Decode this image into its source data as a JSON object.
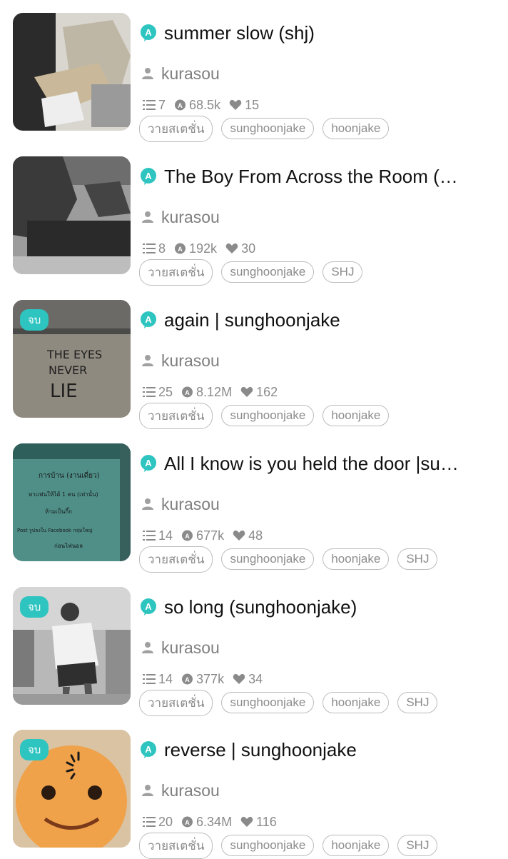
{
  "stories": [
    {
      "title": "summer slow (shj)",
      "author": "kurasou",
      "parts": "7",
      "reads": "68.5k",
      "votes": "15",
      "completed": false,
      "completed_label": "",
      "tags": [
        "วายสเตชั่น",
        "sunghoonjake",
        "hoonjake"
      ]
    },
    {
      "title": "The Boy  From Across the Room (…",
      "author": "kurasou",
      "parts": "8",
      "reads": "192k",
      "votes": "30",
      "completed": false,
      "completed_label": "",
      "tags": [
        "วายสเตชั่น",
        "sunghoonjake",
        "SHJ"
      ]
    },
    {
      "title": "again | sunghoonjake",
      "author": "kurasou",
      "parts": "25",
      "reads": "8.12M",
      "votes": "162",
      "completed": true,
      "completed_label": "จบ",
      "tags": [
        "วายสเตชั่น",
        "sunghoonjake",
        "hoonjake"
      ]
    },
    {
      "title": "All I know is you held the door |su…",
      "author": "kurasou",
      "parts": "14",
      "reads": "677k",
      "votes": "48",
      "completed": false,
      "completed_label": "",
      "tags": [
        "วายสเตชั่น",
        "sunghoonjake",
        "hoonjake",
        "SHJ"
      ]
    },
    {
      "title": "so long (sunghoonjake)",
      "author": "kurasou",
      "parts": "14",
      "reads": "377k",
      "votes": "34",
      "completed": true,
      "completed_label": "จบ",
      "tags": [
        "วายสเตชั่น",
        "sunghoonjake",
        "hoonjake",
        "SHJ"
      ]
    },
    {
      "title": "reverse | sunghoonjake",
      "author": "kurasou",
      "parts": "20",
      "reads": "6.34M",
      "votes": "116",
      "completed": true,
      "completed_label": "จบ",
      "tags": [
        "วายสเตชั่น",
        "sunghoonjake",
        "hoonjake",
        "SHJ"
      ]
    }
  ],
  "cover_texts": {
    "cover3": [
      "THE EYES",
      "NEVER",
      "LIE"
    ],
    "cover4": [
      "การบ้าน (งานเดี่ยว)",
      "หาแฟนให้ได้ 1 คน (เท่านั้น)",
      "ห้ามเป็นกิ๊ก",
      "Post รูปลงใน Facebook กลุ่มใหญ่",
      "ก่อนไฟนอล"
    ]
  },
  "icons": {
    "badge": "a-badge-icon",
    "author": "person-icon",
    "parts": "list-icon",
    "reads": "reads-icon",
    "votes": "heart-icon"
  },
  "colors": {
    "accent": "#2ec4c0",
    "text": "#111111",
    "muted": "#8a8a8a",
    "tag_border": "#bcbcbc"
  }
}
